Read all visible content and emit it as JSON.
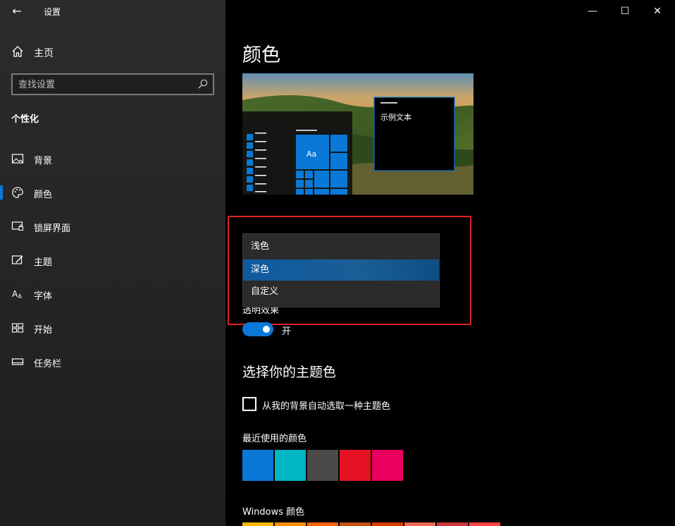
{
  "window": {
    "title": "设置",
    "back_glyph": "←",
    "minimize_glyph": "—",
    "maximize_glyph": "☐",
    "close_glyph": "✕"
  },
  "sidebar": {
    "home_label": "主页",
    "search_placeholder": "查找设置",
    "section_header": "个性化",
    "items": [
      {
        "label": "背景",
        "icon": "picture-icon",
        "active": false
      },
      {
        "label": "颜色",
        "icon": "palette-icon",
        "active": true
      },
      {
        "label": "锁屏界面",
        "icon": "lock-screen-icon",
        "active": false
      },
      {
        "label": "主题",
        "icon": "theme-brush-icon",
        "active": false
      },
      {
        "label": "字体",
        "icon": "font-icon",
        "active": false
      },
      {
        "label": "开始",
        "icon": "start-grid-icon",
        "active": false
      },
      {
        "label": "任务栏",
        "icon": "taskbar-icon",
        "active": false
      }
    ],
    "accent_indicator_color": "#0a78d7"
  },
  "main": {
    "page_title": "颜色",
    "preview": {
      "sample_text": "示例文本",
      "tile_label": "Aa"
    },
    "mode_dropdown": {
      "options": [
        "浅色",
        "深色",
        "自定义"
      ],
      "selected": "深色"
    },
    "transparency": {
      "label": "透明效果",
      "state_label": "开",
      "on": true
    },
    "accent_section_title": "选择你的主题色",
    "auto_pick_label": "从我的背景自动选取一种主题色",
    "auto_pick_checked": false,
    "recent_colors_label": "最近使用的颜色",
    "recent_colors": [
      "#0a78d7",
      "#00b7c3",
      "#4c4a48",
      "#e81123",
      "#ea005e"
    ],
    "windows_colors_label": "Windows 颜色",
    "windows_colors": [
      "#ffb900",
      "#ff8c00",
      "#f7630c",
      "#ca5010",
      "#da3b01",
      "#ef6950",
      "#d13438",
      "#ff4343"
    ]
  },
  "colors": {
    "accent": "#0a78d7",
    "highlight_box": "#e02222"
  }
}
